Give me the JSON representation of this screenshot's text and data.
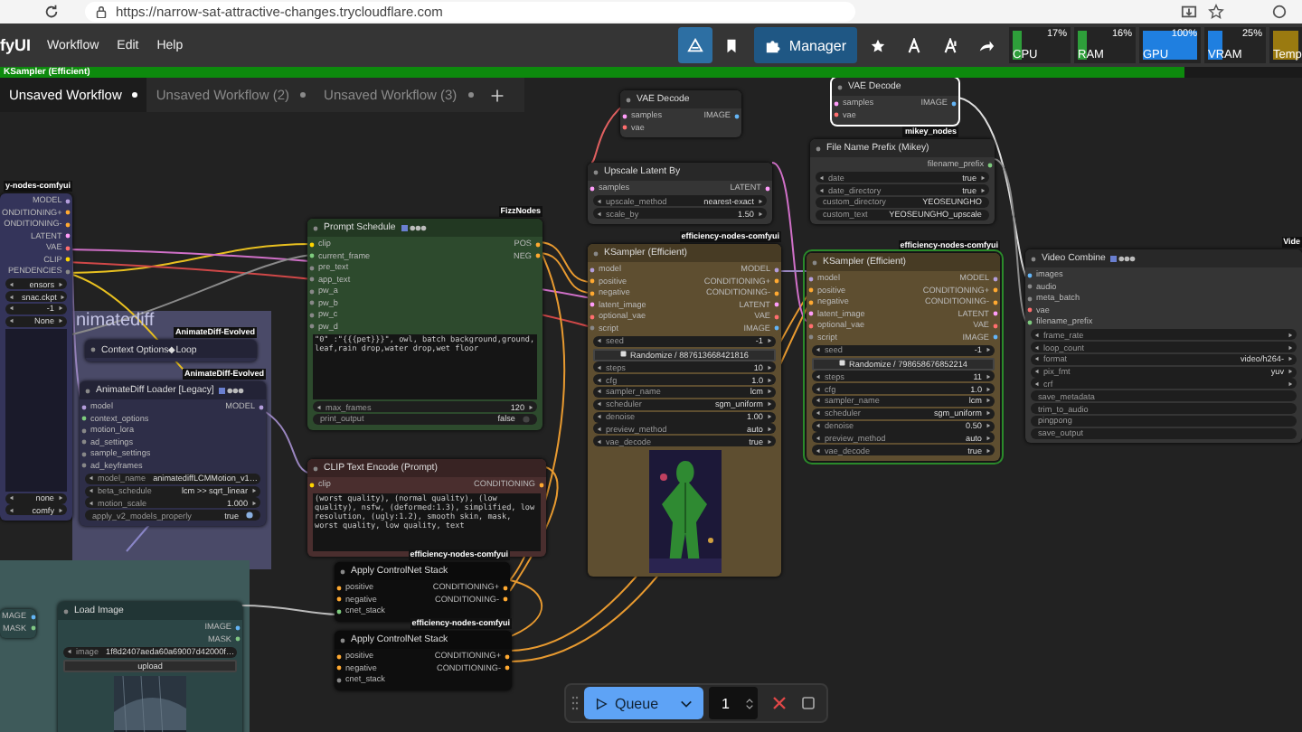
{
  "browser": {
    "url": "https://narrow-sat-attractive-changes.trycloudflare.com"
  },
  "menubar": {
    "logo": "fyUI",
    "menus": [
      "Workflow",
      "Edit",
      "Help"
    ],
    "manager": "Manager",
    "monitors": [
      {
        "label": "CPU",
        "reading": "17%",
        "level": 0.17,
        "color": "#2e9e3a"
      },
      {
        "label": "RAM",
        "reading": "16%",
        "level": 0.16,
        "color": "#2e9e3a"
      },
      {
        "label": "GPU",
        "reading": "100%",
        "level": 1.0,
        "color": "#1f7fe0"
      },
      {
        "label": "VRAM",
        "reading": "25%",
        "level": 0.25,
        "color": "#1f7fe0"
      },
      {
        "label": "Temp",
        "level": 1.0,
        "color": "#9a7a10"
      }
    ]
  },
  "progress": {
    "label": "KSampler (Efficient)",
    "level": 0.91
  },
  "tabs": [
    {
      "label": "Unsaved Workflow",
      "selected": true
    },
    {
      "label": "Unsaved Workflow (2)",
      "selected": false
    },
    {
      "label": "Unsaved Workflow (3)",
      "selected": false
    }
  ],
  "groups": [
    {
      "title": "nimatediff",
      "color": "#4a4a68"
    },
    {
      "color": "#3e5a5a"
    }
  ],
  "nodes": [
    {
      "tag": "y-nodes-comfyui",
      "color": "#34345a",
      "selected": false,
      "running": false,
      "outputs": [
        {
          "label": "MODEL",
          "color": "#b39ddb"
        },
        {
          "label": "ONDITIONING+",
          "color": "#ffa931"
        },
        {
          "label": "ONDITIONING-",
          "color": "#ffa931"
        },
        {
          "label": "LATENT",
          "color": "#ff9cf9"
        },
        {
          "label": "VAE",
          "color": "#ff6e6e"
        },
        {
          "label": "CLIP",
          "color": "#ffd500"
        },
        {
          "label": "PENDENCIES",
          "color": "#888888"
        }
      ],
      "widgets": [
        {
          "kind": "combo",
          "value": "ensors"
        },
        {
          "kind": "combo",
          "value": "snac.ckpt"
        },
        {
          "kind": "combo",
          "value": "-1"
        },
        {
          "kind": "combo",
          "value": "None"
        },
        {
          "kind": "gap"
        },
        {
          "kind": "combo",
          "value": "none"
        },
        {
          "kind": "combo",
          "value": "comfy"
        }
      ]
    },
    {
      "title": "Context Options◆Loop",
      "tag": "AnimateDiff-Evolved",
      "color": "#2e2e48",
      "selected": false,
      "running": false
    },
    {
      "title": "AnimateDiff Loader [Legacy]",
      "tag": "AnimateDiff-Evolved",
      "badge_icons": true,
      "color": "#2e2e48",
      "selected": false,
      "running": false,
      "inputs": [
        {
          "label": "model",
          "color": "#b39ddb"
        },
        {
          "label": "context_options",
          "color": "#7ecb7e"
        },
        {
          "label": "motion_lora",
          "color": "#888888"
        },
        {
          "label": "ad_settings",
          "color": "#888888"
        },
        {
          "label": "sample_settings",
          "color": "#888888"
        },
        {
          "label": "ad_keyframes",
          "color": "#888888"
        }
      ],
      "outputs": [
        {
          "label": "MODEL",
          "color": "#b39ddb"
        }
      ],
      "widgets": [
        {
          "kind": "combo",
          "label": "model_name",
          "value": "animatediffLCMMotion_v1…"
        },
        {
          "kind": "combo",
          "label": "beta_schedule",
          "value": "lcm >> sqrt_linear"
        },
        {
          "kind": "combo",
          "label": "motion_scale",
          "value": "1.000"
        },
        {
          "kind": "toggle",
          "label": "apply_v2_models_properly",
          "value": "true",
          "on": true
        }
      ]
    },
    {
      "title": "Prompt Schedule",
      "tag": "FizzNodes",
      "badge_icons": true,
      "color": "#2d4a2d",
      "selected": false,
      "running": false,
      "inputs": [
        {
          "label": "clip",
          "color": "#ffd500"
        },
        {
          "label": "current_frame",
          "color": "#7ecb7e"
        },
        {
          "label": "pre_text",
          "color": "#888888"
        },
        {
          "label": "app_text",
          "color": "#888888"
        },
        {
          "label": "pw_a",
          "color": "#888888"
        },
        {
          "label": "pw_b",
          "color": "#888888"
        },
        {
          "label": "pw_c",
          "color": "#888888"
        },
        {
          "label": "pw_d",
          "color": "#888888"
        }
      ],
      "outputs": [
        {
          "label": "POS",
          "color": "#ffa931"
        },
        {
          "label": "NEG",
          "color": "#ffa931"
        }
      ],
      "text": "\"0\" :\"{{{pet}}}\", owl, batch background,ground, leaf,rain drop,water drop,wet floor",
      "widgets": [
        {
          "kind": "combo",
          "label": "max_frames",
          "value": "120"
        },
        {
          "kind": "toggle",
          "label": "print_output",
          "value": "false",
          "on": false
        }
      ]
    },
    {
      "title": "CLIP Text Encode (Prompt)",
      "color": "#4a2e2e",
      "selected": false,
      "running": false,
      "inputs": [
        {
          "label": "clip",
          "color": "#ffd500"
        }
      ],
      "outputs": [
        {
          "label": "CONDITIONING",
          "color": "#ffa931"
        }
      ],
      "text": "(worst quality), (normal quality), (low quality), nsfw, (deformed:1.3), simplified, low resolution, (ugly:1.2), smooth skin, mask, worst quality, low quality, text"
    },
    {
      "title": "Load Image",
      "color": "#2c4646",
      "selected": false,
      "running": false,
      "outputs": [
        {
          "label": "IMAGE",
          "color": "#64b5f6"
        },
        {
          "label": "MASK",
          "color": "#81c784"
        }
      ],
      "widgets": [
        {
          "kind": "combo",
          "label": "image",
          "value": "1f8d2407aeda60a69007d42000f…"
        },
        {
          "kind": "button",
          "value": "upload"
        }
      ],
      "image": {
        "kind": "picture"
      }
    },
    {
      "color": "#2c4646",
      "selected": false,
      "running": false,
      "outputs": [
        {
          "label": "MAGE",
          "color": "#64b5f6"
        },
        {
          "label": "MASK",
          "color": "#81c784"
        }
      ]
    },
    {
      "title": "Apply ControlNet Stack",
      "tag": "efficiency-nodes-comfyui",
      "color": "#0e0e0e",
      "selected": false,
      "running": false,
      "inputs": [
        {
          "label": "positive",
          "color": "#ffa931"
        },
        {
          "label": "negative",
          "color": "#ffa931"
        },
        {
          "label": "cnet_stack",
          "color": "#7ecb7e"
        }
      ],
      "outputs": [
        {
          "label": "CONDITIONING+",
          "color": "#ffa931"
        },
        {
          "label": "CONDITIONING-",
          "color": "#ffa931"
        }
      ]
    },
    {
      "title": "Apply ControlNet Stack",
      "tag": "efficiency-nodes-comfyui",
      "color": "#0e0e0e",
      "selected": false,
      "running": false,
      "inputs": [
        {
          "label": "positive",
          "color": "#ffa931"
        },
        {
          "label": "negative",
          "color": "#ffa931"
        },
        {
          "label": "cnet_stack",
          "color": "#888888"
        }
      ],
      "outputs": [
        {
          "label": "CONDITIONING+",
          "color": "#ffa931"
        },
        {
          "label": "CONDITIONING-",
          "color": "#ffa931"
        }
      ]
    },
    {
      "title": "VAE Decode",
      "color": "#353535",
      "selected": false,
      "running": false,
      "inputs": [
        {
          "label": "samples",
          "color": "#ff9cf9"
        },
        {
          "label": "vae",
          "color": "#ff6e6e"
        }
      ],
      "outputs": [
        {
          "label": "IMAGE",
          "color": "#64b5f6"
        }
      ]
    },
    {
      "title": "Upscale Latent By",
      "color": "#353535",
      "selected": false,
      "running": false,
      "inputs": [
        {
          "label": "samples",
          "color": "#ff9cf9"
        }
      ],
      "outputs": [
        {
          "label": "LATENT",
          "color": "#ff9cf9"
        }
      ],
      "widgets": [
        {
          "kind": "combo",
          "label": "upscale_method",
          "value": "nearest-exact"
        },
        {
          "kind": "combo",
          "label": "scale_by",
          "value": "1.50"
        }
      ]
    },
    {
      "title": "KSampler (Efficient)",
      "tag": "efficiency-nodes-comfyui",
      "color": "#5e4e30",
      "selected": false,
      "running": false,
      "inputs": [
        {
          "label": "model",
          "color": "#b39ddb"
        },
        {
          "label": "positive",
          "color": "#ffa931"
        },
        {
          "label": "negative",
          "color": "#ffa931"
        },
        {
          "label": "latent_image",
          "color": "#ff9cf9"
        },
        {
          "label": "optional_vae",
          "color": "#ff6e6e"
        },
        {
          "label": "script",
          "color": "#888888"
        }
      ],
      "outputs": [
        {
          "label": "MODEL",
          "color": "#b39ddb"
        },
        {
          "label": "CONDITIONING+",
          "color": "#ffa931"
        },
        {
          "label": "CONDITIONING-",
          "color": "#ffa931"
        },
        {
          "label": "LATENT",
          "color": "#ff9cf9"
        },
        {
          "label": "VAE",
          "color": "#ff6e6e"
        },
        {
          "label": "IMAGE",
          "color": "#64b5f6"
        }
      ],
      "widgets": [
        {
          "kind": "combo",
          "label": "seed",
          "value": "-1"
        },
        {
          "kind": "randomize",
          "value": "Randomize / 887613668421816"
        },
        {
          "kind": "combo",
          "label": "steps",
          "value": "10"
        },
        {
          "kind": "combo",
          "label": "cfg",
          "value": "1.0"
        },
        {
          "kind": "combo",
          "label": "sampler_name",
          "value": "lcm"
        },
        {
          "kind": "combo",
          "label": "scheduler",
          "value": "sgm_uniform"
        },
        {
          "kind": "combo",
          "label": "denoise",
          "value": "1.00"
        },
        {
          "kind": "combo",
          "label": "preview_method",
          "value": "auto"
        },
        {
          "kind": "combo",
          "label": "vae_decode",
          "value": "true"
        }
      ],
      "image": {
        "kind": "picture"
      }
    },
    {
      "title": "VAE Decode",
      "tag": "mikey_nodes",
      "color": "#353535",
      "selected": true,
      "running": false,
      "inputs": [
        {
          "label": "samples",
          "color": "#ff9cf9"
        },
        {
          "label": "vae",
          "color": "#ff6e6e"
        }
      ],
      "outputs": [
        {
          "label": "IMAGE",
          "color": "#64b5f6"
        }
      ]
    },
    {
      "title": "File Name Prefix (Mikey)",
      "color": "#353535",
      "selected": false,
      "running": false,
      "outputs": [
        {
          "label": "filename_prefix",
          "color": "#7ecb7e"
        }
      ],
      "widgets": [
        {
          "kind": "combo",
          "label": "date",
          "value": "true"
        },
        {
          "kind": "combo",
          "label": "date_directory",
          "value": "true"
        },
        {
          "kind": "text",
          "label": "custom_directory",
          "value": "YEOSEUNGHO"
        },
        {
          "kind": "text",
          "label": "custom_text",
          "value": "YEOSEUNGHO_upscale"
        }
      ]
    },
    {
      "title": "KSampler (Efficient)",
      "tag": "efficiency-nodes-comfyui",
      "color": "#5e4e30",
      "selected": false,
      "running": true,
      "inputs": [
        {
          "label": "model",
          "color": "#b39ddb"
        },
        {
          "label": "positive",
          "color": "#ffa931"
        },
        {
          "label": "negative",
          "color": "#ffa931"
        },
        {
          "label": "latent_image",
          "color": "#ff9cf9"
        },
        {
          "label": "optional_vae",
          "color": "#ff6e6e"
        },
        {
          "label": "script",
          "color": "#888888"
        }
      ],
      "outputs": [
        {
          "label": "MODEL",
          "color": "#b39ddb"
        },
        {
          "label": "CONDITIONING+",
          "color": "#ffa931"
        },
        {
          "label": "CONDITIONING-",
          "color": "#ffa931"
        },
        {
          "label": "LATENT",
          "color": "#ff9cf9"
        },
        {
          "label": "VAE",
          "color": "#ff6e6e"
        },
        {
          "label": "IMAGE",
          "color": "#64b5f6"
        }
      ],
      "widgets": [
        {
          "kind": "combo",
          "label": "seed",
          "value": "-1"
        },
        {
          "kind": "randomize",
          "value": "Randomize / 798658676852214"
        },
        {
          "kind": "combo",
          "label": "steps",
          "value": "11"
        },
        {
          "kind": "combo",
          "label": "cfg",
          "value": "1.0"
        },
        {
          "kind": "combo",
          "label": "sampler_name",
          "value": "lcm"
        },
        {
          "kind": "combo",
          "label": "scheduler",
          "value": "sgm_uniform"
        },
        {
          "kind": "combo",
          "label": "denoise",
          "value": "0.50"
        },
        {
          "kind": "combo",
          "label": "preview_method",
          "value": "auto"
        },
        {
          "kind": "combo",
          "label": "vae_decode",
          "value": "true"
        }
      ]
    },
    {
      "title": "Video Combine",
      "tag": "Vide",
      "badge_icons": true,
      "color": "#353535",
      "selected": false,
      "running": false,
      "inputs": [
        {
          "label": "images",
          "color": "#64b5f6"
        },
        {
          "label": "audio",
          "color": "#888888"
        },
        {
          "label": "meta_batch",
          "color": "#888888"
        },
        {
          "label": "vae",
          "color": "#ff6e6e"
        },
        {
          "label": "filename_prefix",
          "color": "#7ecb7e"
        }
      ],
      "widgets": [
        {
          "kind": "combo",
          "label": "frame_rate"
        },
        {
          "kind": "combo",
          "label": "loop_count"
        },
        {
          "kind": "combo",
          "label": "format",
          "value": "video/h264-"
        },
        {
          "kind": "combo",
          "label": "pix_fmt",
          "value": "yuv"
        },
        {
          "kind": "combo",
          "label": "crf"
        },
        {
          "kind": "text",
          "label": "save_metadata"
        },
        {
          "kind": "text",
          "label": "trim_to_audio"
        },
        {
          "kind": "text",
          "label": "pingpong"
        },
        {
          "kind": "text",
          "label": "save_output"
        }
      ]
    }
  ],
  "queue": {
    "label": "Queue",
    "count": "1"
  }
}
